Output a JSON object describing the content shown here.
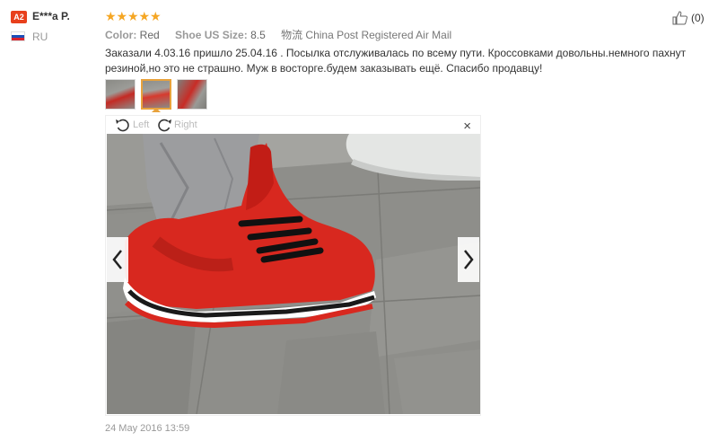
{
  "user": {
    "badge": "A2",
    "name": "E***a P.",
    "country": "RU"
  },
  "rating": {
    "stars": 5,
    "star_color": "#f5a623"
  },
  "attributes": [
    {
      "key": "Color:",
      "value": "Red"
    },
    {
      "key": "Shoe US Size:",
      "value": "8.5"
    }
  ],
  "shipping": "物流 China Post Registered Air Mail",
  "review_text": "Заказали 4.03.16 пришло 25.04.16 . Посылка отслуживалась по всему пути. Кроссовками довольны.немного пахнут резиной,но это не страшно. Муж в восторге.будем заказывать ещё. Спасибо продавцу!",
  "viewer": {
    "rotate_left": "Left",
    "rotate_right": "Right",
    "close": "×"
  },
  "helpful": {
    "count": "(0)"
  },
  "date": "24 May 2016 13:59",
  "colors": {
    "badge": "#e8401c",
    "accent": "#e8a23c"
  }
}
